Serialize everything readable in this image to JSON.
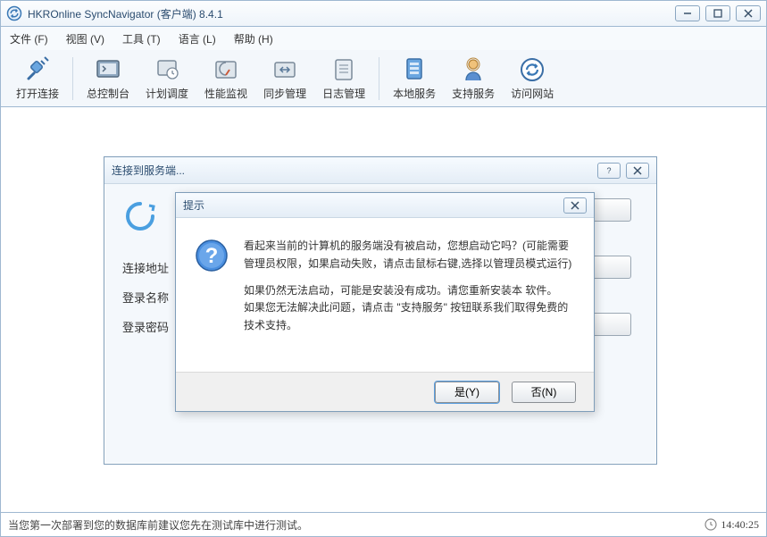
{
  "window": {
    "title": "HKROnline SyncNavigator (客户端) 8.4.1"
  },
  "menu": {
    "file": "文件 (F)",
    "view": "视图 (V)",
    "tools": "工具 (T)",
    "language": "语言 (L)",
    "help": "帮助 (H)"
  },
  "toolbar": {
    "open_conn": "打开连接",
    "console": "总控制台",
    "schedule": "计划调度",
    "perfmon": "性能监视",
    "syncmgr": "同步管理",
    "logmgr": "日志管理",
    "localsvc": "本地服务",
    "support": "支持服务",
    "website": "访问网站"
  },
  "server_panel": {
    "title": "连接到服务端...",
    "addr": "连接地址",
    "login": "登录名称",
    "pwd": "登录密码"
  },
  "msgbox": {
    "title": "提示",
    "line1": "看起来当前的计算机的服务端没有被启动，您想启动它吗？(可能需要管理员权限，如果启动失败，请点击鼠标右键,选择以管理员模式运行)",
    "line2": "如果仍然无法启动，可能是安装没有成功。请您重新安装本 软件。",
    "line3": "如果您无法解决此问题，请点击 \"支持服务\" 按钮联系我们取得免费的技术支持。",
    "yes": "是(Y)",
    "no": "否(N)"
  },
  "status": {
    "left": "当您第一次部署到您的数据库前建议您先在测试库中进行测试。",
    "time": "14:40:25"
  }
}
